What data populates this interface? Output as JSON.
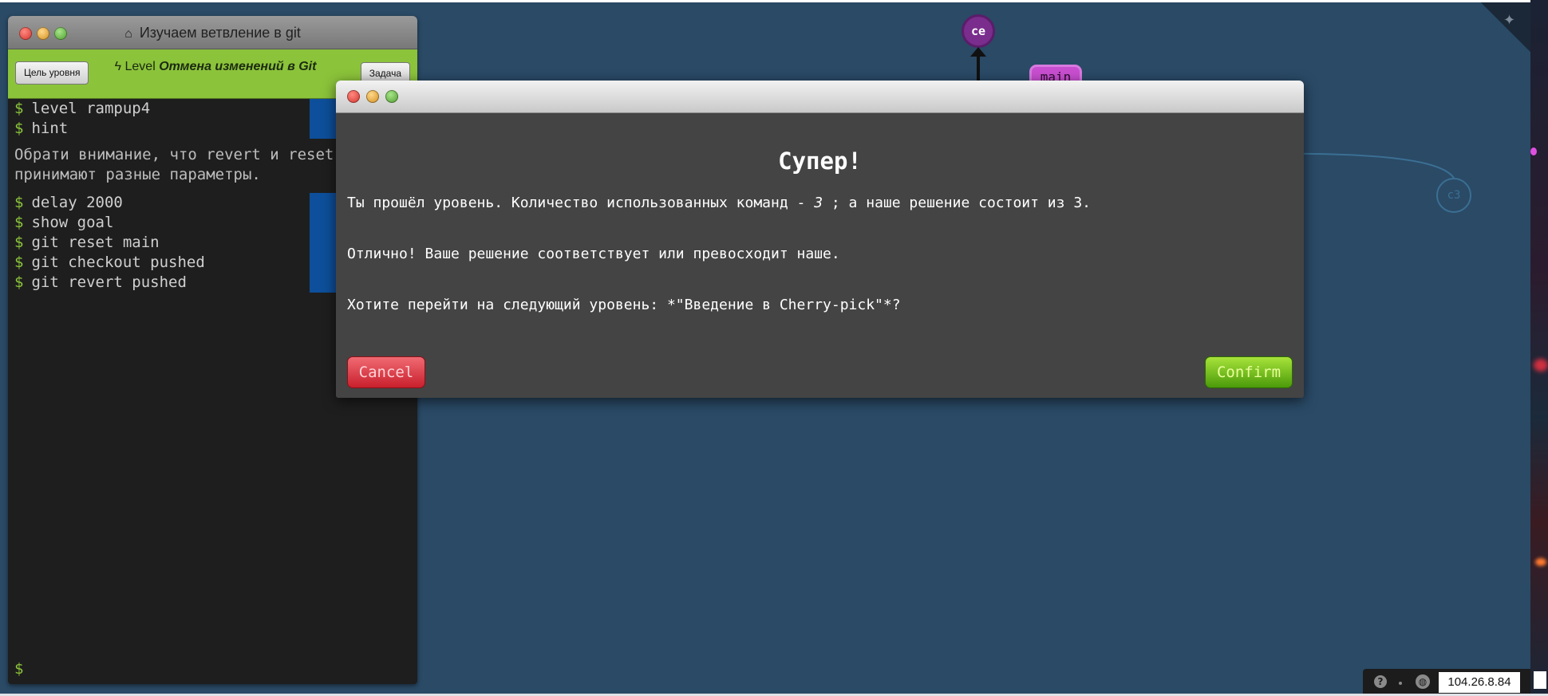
{
  "terminal": {
    "title": "Изучаем ветвление в git",
    "goal_button": "Цель уровня",
    "task_button": "Задача",
    "level_prefix": "Level",
    "level_name": "Отмена изменений в Git",
    "commands_before": [
      "level rampup4",
      "hint"
    ],
    "hint_text": "Обрати внимание, что revert и reset принимают разные параметры.",
    "commands_after": [
      "delay 2000",
      "show goal",
      "git reset main",
      "git checkout pushed",
      "git revert pushed"
    ],
    "prompt": "$"
  },
  "visualization": {
    "node_ce": "ce",
    "branch_main": "main",
    "node_c3": "c3"
  },
  "modal": {
    "title": "Супер!",
    "line1_before": "Ты прошёл уровень. Количество использованных команд - ",
    "line1_count": "3",
    "line1_after": " ; а наше решение состоит из 3.",
    "line2": "Отлично! Ваше решение соответствует или превосходит наше.",
    "line3": "Хотите перейти на следующий уровень: *\"Введение в Cherry-pick\"*?",
    "cancel": "Cancel",
    "confirm": "Confirm"
  },
  "status": {
    "help_icon": "?",
    "ip": "104.26.8.84"
  }
}
